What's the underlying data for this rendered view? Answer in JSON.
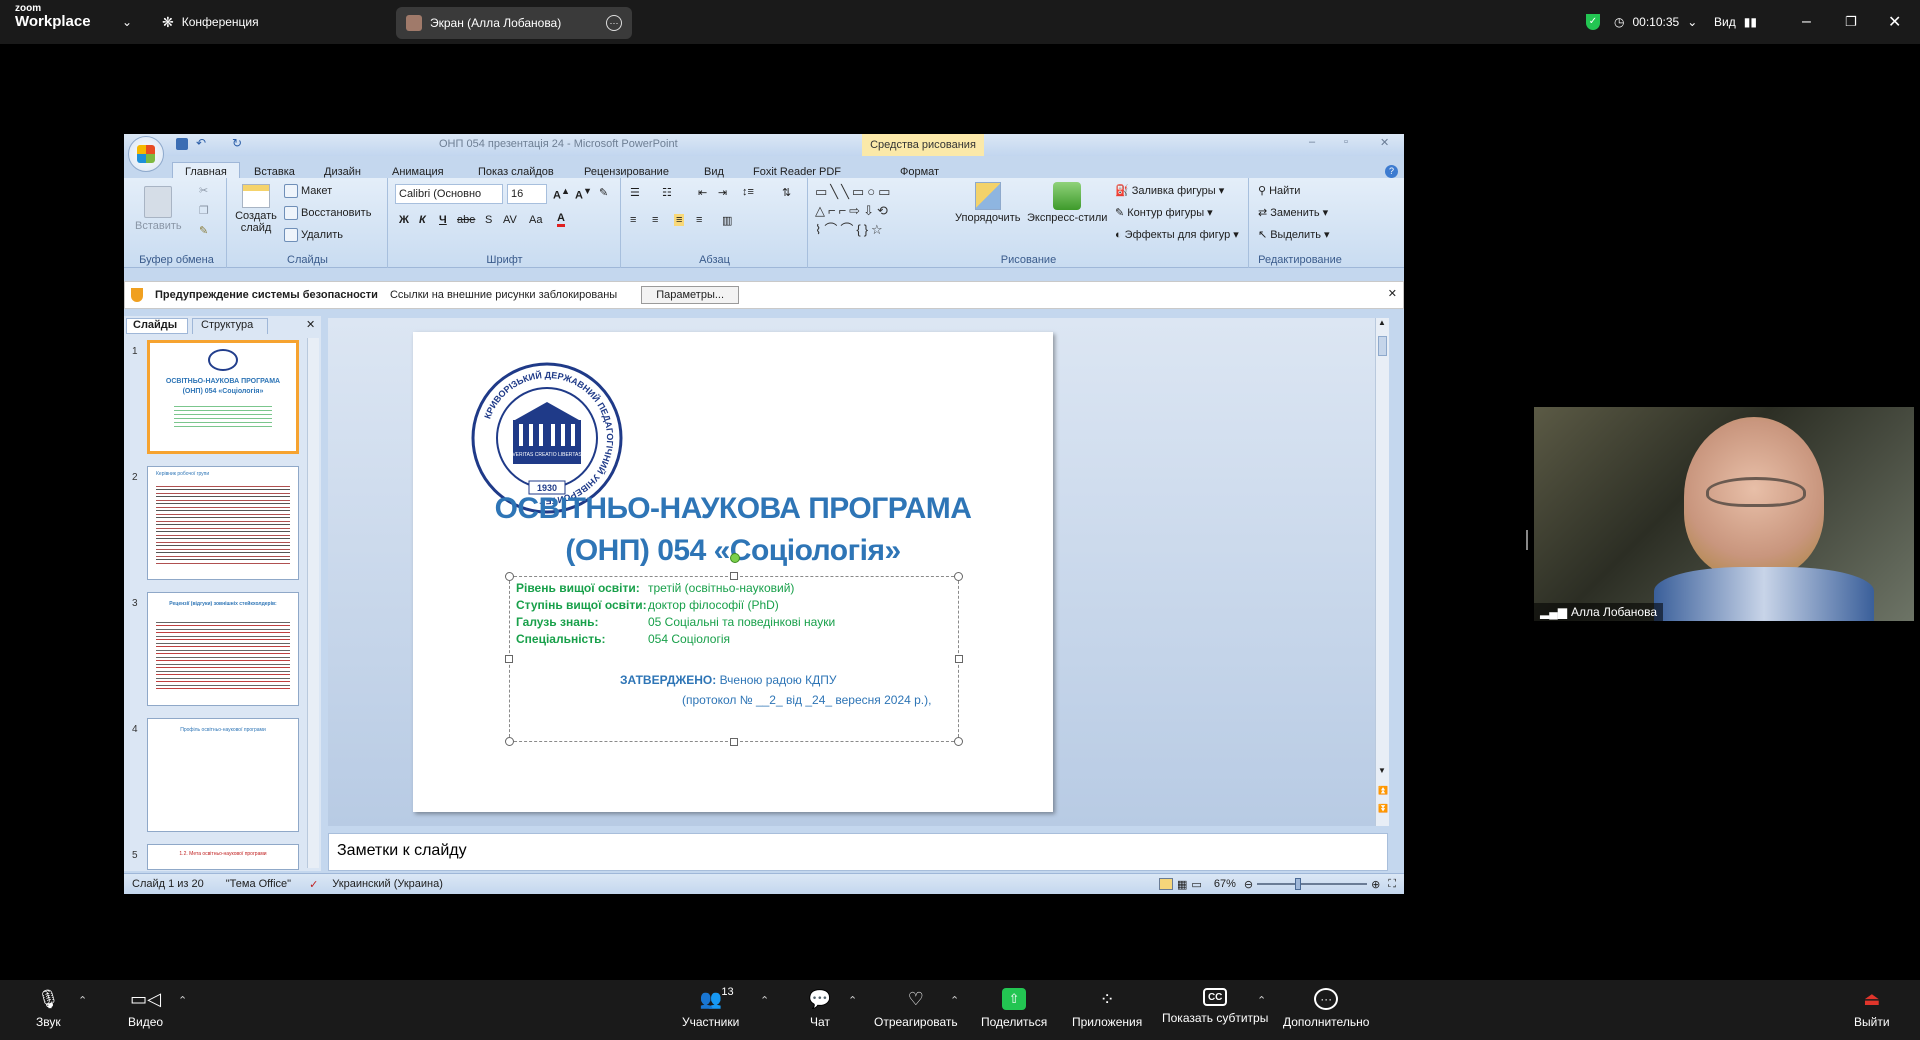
{
  "zoom": {
    "logo_line1": "zoom",
    "logo_line2": "Workplace",
    "conference_label": "Конференция",
    "screen_share_label": "Экран (Алла Лобанова)",
    "timer": "00:10:35",
    "view_label": "Вид",
    "participant_name": "Алла Лобанова",
    "participants_count": "13",
    "bottom": {
      "audio": "Звук",
      "video": "Видео",
      "participants": "Участники",
      "chat": "Чат",
      "react": "Отреагировать",
      "share": "Поделиться",
      "apps": "Приложения",
      "captions": "Показать субтитры",
      "more": "Дополнительно",
      "leave": "Выйти"
    }
  },
  "ppt": {
    "window_title": "ОНП 054 презентація 24 - Microsoft PowerPoint",
    "context_group": "Средства рисования",
    "tabs": [
      "Главная",
      "Вставка",
      "Дизайн",
      "Анимация",
      "Показ слайдов",
      "Рецензирование",
      "Вид",
      "Foxit Reader PDF",
      "Формат"
    ],
    "ribbon": {
      "paste": "Вставить",
      "clipboard": "Буфер обмена",
      "new_slide": "Создать слайд",
      "layout": "Макет",
      "reset": "Восстановить",
      "delete": "Удалить",
      "slides_group": "Слайды",
      "font_name": "Calibri (Основно",
      "font_size": "16",
      "font_group": "Шрифт",
      "paragraph_group": "Абзац",
      "arrange": "Упорядочить",
      "quick_styles": "Экспресс-стили",
      "shape_fill": "Заливка фигуры",
      "shape_outline": "Контур фигуры",
      "shape_effects": "Эффекты для фигур",
      "drawing_group": "Рисование",
      "find": "Найти",
      "replace": "Заменить",
      "select": "Выделить",
      "editing_group": "Редактирование"
    },
    "security": {
      "title": "Предупреждение системы безопасности",
      "message": "Ссылки на внешние рисунки заблокированы",
      "button": "Параметры..."
    },
    "panel_tabs": [
      "Слайды",
      "Структура"
    ],
    "thumbs": [
      {
        "num": "1",
        "title": "ОСВІТНЬО-НАУКОВА ПРОГРАМА (ОНП) 054 «Соціологія»"
      },
      {
        "num": "2",
        "title": "Керівник робочої групи"
      },
      {
        "num": "3",
        "title": "Рецензії (відгуки) зовнішніх стейкхолдерів:"
      },
      {
        "num": "4",
        "title": "Профіль освітньо-наукової програми"
      },
      {
        "num": "5",
        "title": "1.2. Мета освітньо-наукової програми"
      }
    ],
    "slide": {
      "seal_text": "КРИВОРІЗЬКИЙ ДЕРЖАВНИЙ ПЕДАГОГІЧНИЙ УНІВЕРСИТЕТ",
      "seal_motto": "VERITAS CREATIO LIBERTAS",
      "seal_year": "1930",
      "title_line1": "ОСВІТНЬО-НАУКОВА ПРОГРАМА",
      "title_line2": "(ОНП) 054 «Соціологія»",
      "rows": [
        {
          "label": "Рівень вищої освіти:",
          "value": "третій (освітньо-науковий)"
        },
        {
          "label": "Ступінь вищої освіти:",
          "value": "доктор філософії (PhD)"
        },
        {
          "label": "Галузь знань:",
          "value": "05 Соціальні та поведінкові науки"
        },
        {
          "label": "Спеціальність:",
          "value": "054 Соціологія"
        }
      ],
      "approved_label": "ЗАТВЕРДЖЕНО:",
      "approved_value": "Вченою радою КДПУ",
      "protocol": "(протокол  №  __2_  від  _24_  вересня 2024 р.),"
    },
    "notes_placeholder": "Заметки к слайду",
    "status": {
      "slide_info": "Слайд 1 из 20",
      "theme": "\"Тема Office\"",
      "language": "Украинский (Украина)",
      "zoom": "67%"
    }
  }
}
